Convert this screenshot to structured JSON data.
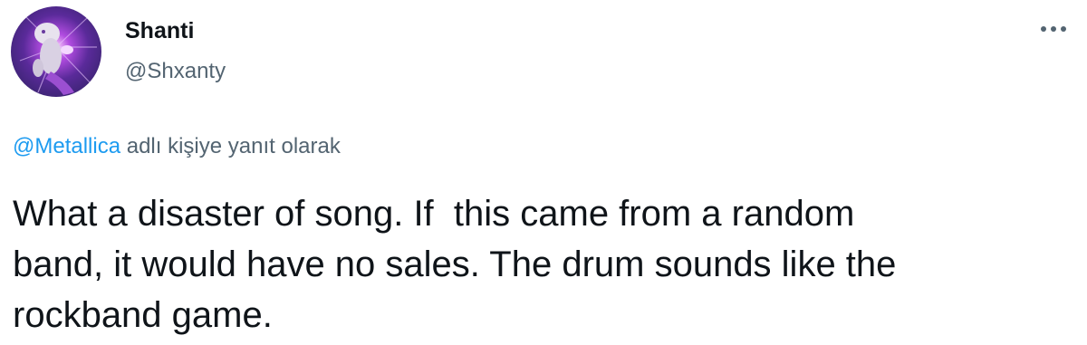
{
  "author": {
    "display_name": "Shanti",
    "handle": "@Shxanty",
    "avatar_icon": "avatar-image"
  },
  "more_icon": "more-dots-icon",
  "reply_context": {
    "mention": "@Metallica",
    "suffix_text": " adlı kişiye yanıt olarak"
  },
  "tweet_text": {
    "lines": [
      "What a disaster of song. If  this came from a random",
      "band, it would have no sales. The drum sounds like the",
      "rockband game."
    ]
  },
  "colors": {
    "text_primary": "#0f1419",
    "text_secondary": "#536471",
    "link": "#1d9bf0",
    "background": "#ffffff"
  }
}
